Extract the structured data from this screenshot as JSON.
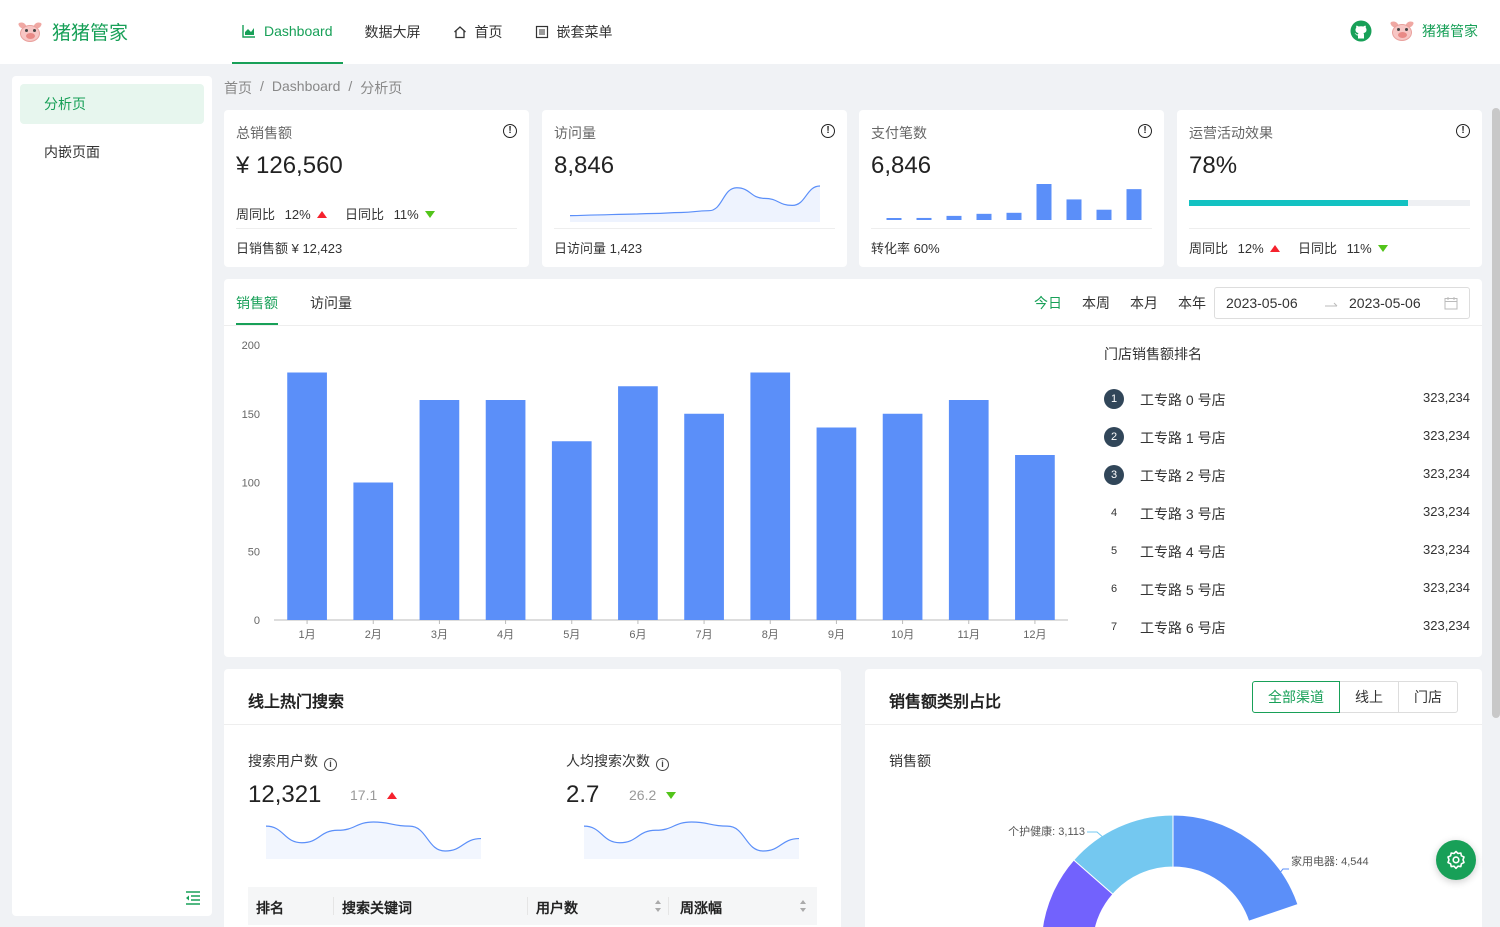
{
  "app": {
    "title": "猪猪管家"
  },
  "nav": {
    "items": [
      {
        "label": "Dashboard",
        "icon": "area-chart-icon",
        "active": true
      },
      {
        "label": "数据大屏",
        "icon": ""
      },
      {
        "label": "首页",
        "icon": "home-icon"
      },
      {
        "label": "嵌套菜单",
        "icon": "list-icon"
      }
    ]
  },
  "header": {
    "user_name": "猪猪管家"
  },
  "sidebar": {
    "items": [
      {
        "label": "分析页",
        "active": true
      },
      {
        "label": "内嵌页面",
        "active": false
      }
    ]
  },
  "breadcrumb": [
    "首页",
    "Dashboard",
    "分析页"
  ],
  "stats": {
    "total_sales": {
      "title": "总销售额",
      "value": "¥ 126,560",
      "week_label": "周同比",
      "week_value": "12%",
      "day_label": "日同比",
      "day_value": "11%",
      "footer": "日销售额  ¥ 12,423"
    },
    "visits": {
      "title": "访问量",
      "value": "8,846",
      "footer": "日访问量  1,423"
    },
    "payments": {
      "title": "支付笔数",
      "value": "6,846",
      "footer": "转化率  60%"
    },
    "ops": {
      "title": "运营活动效果",
      "value": "78%",
      "progress": 0.78,
      "week_label": "周同比",
      "week_value": "12%",
      "day_label": "日同比",
      "day_value": "11%"
    }
  },
  "sales_card": {
    "tabs": [
      "销售额",
      "访问量"
    ],
    "ranges": [
      "今日",
      "本周",
      "本月",
      "本年"
    ],
    "date_start": "2023-05-06",
    "date_end": "2023-05-06",
    "rank_title": "门店销售额排名",
    "rank": [
      {
        "num": "1",
        "name": "工专路 0 号店",
        "value": "323,234"
      },
      {
        "num": "2",
        "name": "工专路 1 号店",
        "value": "323,234"
      },
      {
        "num": "3",
        "name": "工专路 2 号店",
        "value": "323,234"
      },
      {
        "num": "4",
        "name": "工专路 3 号店",
        "value": "323,234"
      },
      {
        "num": "5",
        "name": "工专路 4 号店",
        "value": "323,234"
      },
      {
        "num": "6",
        "name": "工专路 5 号店",
        "value": "323,234"
      },
      {
        "num": "7",
        "name": "工专路 6 号店",
        "value": "323,234"
      }
    ]
  },
  "search_card": {
    "title": "线上热门搜索",
    "users_label": "搜索用户数",
    "users_value": "12,321",
    "users_sub": "17.1",
    "avg_label": "人均搜索次数",
    "avg_value": "2.7",
    "avg_sub": "26.2",
    "table_headers": [
      "排名",
      "搜索关键词",
      "用户数",
      "周涨幅"
    ]
  },
  "category_card": {
    "title": "销售额类别占比",
    "segments": [
      "全部渠道",
      "线上",
      "门店"
    ],
    "subtitle": "销售额"
  },
  "colors": {
    "primary": "#18a058",
    "bar": "#5b8ff9",
    "progress": "#13c2c2"
  },
  "chart_data": [
    {
      "type": "bar",
      "categories": [
        "1月",
        "2月",
        "3月",
        "4月",
        "5月",
        "6月",
        "7月",
        "8月",
        "9月",
        "10月",
        "11月",
        "12月"
      ],
      "values": [
        180,
        100,
        160,
        160,
        130,
        170,
        150,
        180,
        140,
        150,
        160,
        120
      ],
      "ylim": [
        0,
        200
      ],
      "yticks": [
        0,
        50,
        100,
        150,
        200
      ],
      "grid": false
    },
    {
      "type": "area",
      "values": [
        1,
        3,
        5,
        7,
        10,
        15,
        80,
        50,
        30,
        85
      ],
      "note_only_shape": true
    },
    {
      "type": "bar",
      "values": [
        1,
        2,
        4,
        6,
        7,
        35,
        20,
        10,
        30
      ],
      "note_only_shape": true
    },
    {
      "type": "line",
      "values": [
        7,
        3,
        6,
        8,
        7,
        1,
        4
      ]
    },
    {
      "type": "line",
      "values": [
        7,
        3,
        6,
        8,
        7,
        1,
        4
      ]
    },
    {
      "type": "pie",
      "categories": [
        "家用电器",
        "个护健康"
      ],
      "values": [
        4544,
        3113
      ]
    }
  ]
}
